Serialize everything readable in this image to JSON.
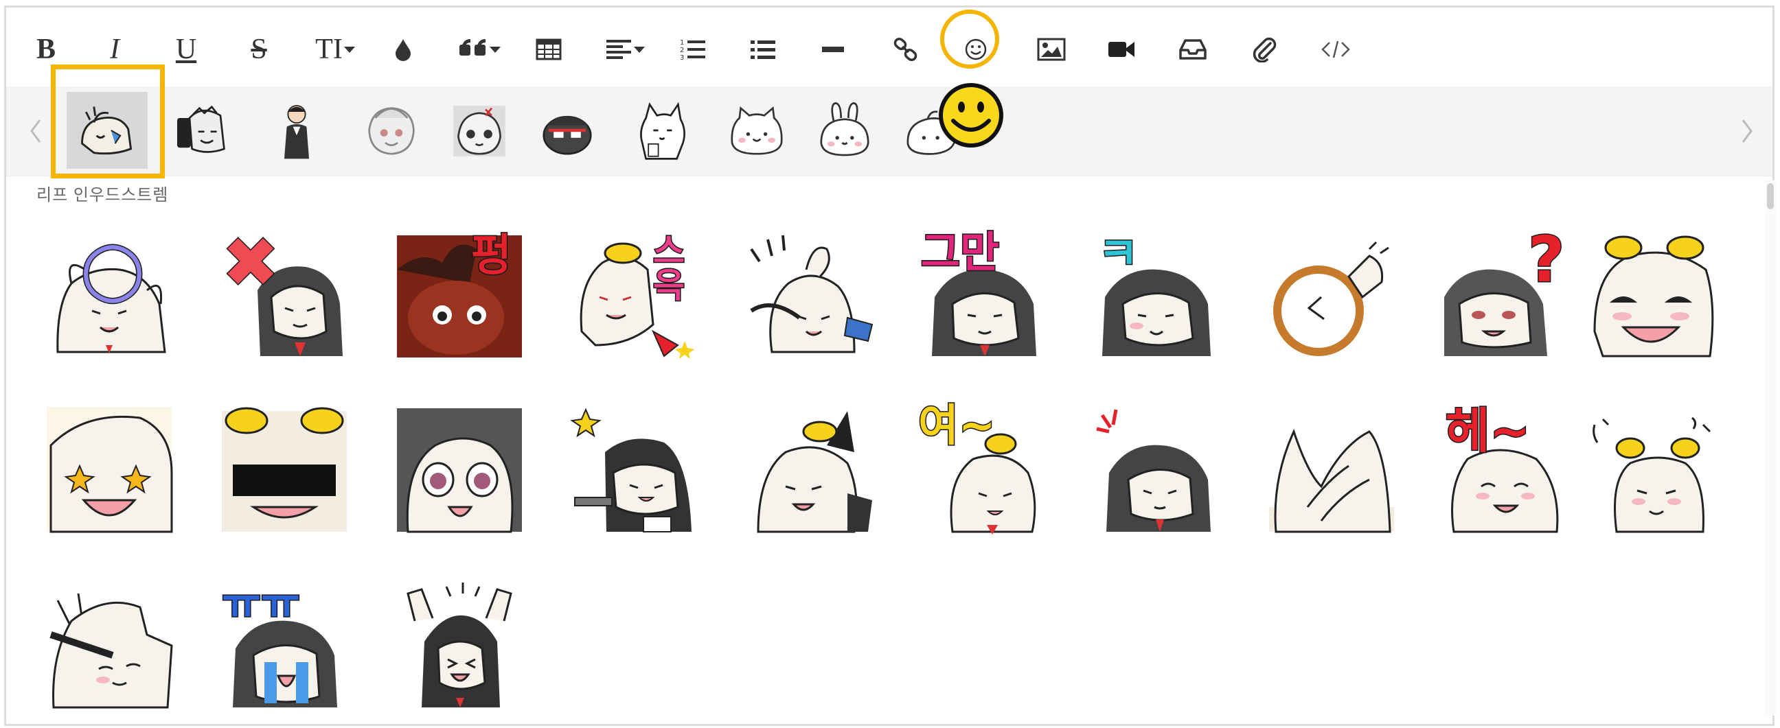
{
  "toolbar": {
    "buttons": [
      {
        "name": "bold-button",
        "label": "B"
      },
      {
        "name": "italic-button",
        "label": "I"
      },
      {
        "name": "underline-button",
        "label": "U"
      },
      {
        "name": "strikethrough-button",
        "label": "S"
      },
      {
        "name": "text-size-button",
        "label": "TI"
      },
      {
        "name": "text-color-button",
        "icon": "ink-drop-icon"
      },
      {
        "name": "quote-button",
        "icon": "quote-icon"
      },
      {
        "name": "table-button",
        "icon": "table-icon"
      },
      {
        "name": "align-button",
        "icon": "align-left-icon"
      },
      {
        "name": "ordered-list-button",
        "icon": "ordered-list-icon"
      },
      {
        "name": "unordered-list-button",
        "icon": "bullet-list-icon"
      },
      {
        "name": "horizontal-rule-button",
        "icon": "minus-icon"
      },
      {
        "name": "link-button",
        "icon": "link-icon"
      },
      {
        "name": "emoticon-button",
        "icon": "smiley-icon"
      },
      {
        "name": "image-button",
        "icon": "image-icon"
      },
      {
        "name": "video-button",
        "icon": "video-camera-icon"
      },
      {
        "name": "box-button",
        "icon": "inbox-icon"
      },
      {
        "name": "attach-file-button",
        "icon": "paperclip-icon"
      },
      {
        "name": "code-button",
        "icon": "code-icon"
      }
    ],
    "highlight_color": "#f5b400"
  },
  "emoticon_tabs": {
    "count": 10,
    "selected_index": 0
  },
  "sticker_pack": {
    "name": "리프 인우드스트렘",
    "rows": [
      [
        {
          "overlay": "○",
          "color": "#8b84e8"
        },
        {
          "overlay": "✖",
          "color": "#f04a55"
        },
        {
          "overlay": "펑",
          "color": "#e5222b"
        },
        {
          "overlay": "스윽",
          "color": "#ec3d8a"
        },
        {
          "overlay": "",
          "color": ""
        },
        {
          "overlay": "그만",
          "color": "#e0267a"
        },
        {
          "overlay": "ㅋ",
          "color": "#2ec4d6"
        },
        {
          "overlay": "",
          "color": ""
        },
        {
          "overlay": "?",
          "color": "#e5222b"
        },
        {
          "overlay": "",
          "color": ""
        }
      ],
      [
        {
          "overlay": "",
          "color": ""
        },
        {
          "overlay": "",
          "color": ""
        },
        {
          "overlay": "",
          "color": ""
        },
        {
          "overlay": "",
          "color": ""
        },
        {
          "overlay": "",
          "color": ""
        },
        {
          "overlay": "여~",
          "color": "#f6d21c"
        },
        {
          "overlay": "",
          "color": ""
        },
        {
          "overlay": "",
          "color": ""
        },
        {
          "overlay": "헤~",
          "color": "#e5222b"
        },
        {
          "overlay": "",
          "color": ""
        }
      ],
      [
        {
          "overlay": "",
          "color": ""
        },
        {
          "overlay": "ㅠㅠ",
          "color": "#2a62d8"
        },
        {
          "overlay": "",
          "color": ""
        }
      ]
    ]
  }
}
